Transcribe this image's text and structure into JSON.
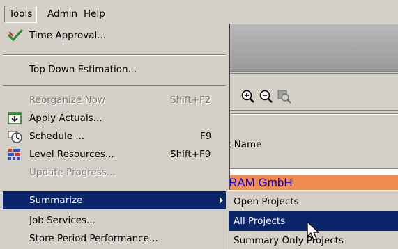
{
  "menubar": {
    "items": [
      {
        "label": "Tools"
      },
      {
        "label": "Admin"
      },
      {
        "label": "Help"
      }
    ]
  },
  "tools_menu": {
    "items": [
      {
        "label": "Time Approval...",
        "icon": "checkmark-icon"
      },
      {
        "label": "Top Down Estimation..."
      },
      {
        "label": "Reorganize Now",
        "shortcut": "Shift+F2",
        "disabled": true
      },
      {
        "label": "Apply Actuals...",
        "icon": "apply-actuals-icon"
      },
      {
        "label": "Schedule ...",
        "shortcut": "F9",
        "icon": "schedule-clock-icon"
      },
      {
        "label": "Level Resources...",
        "shortcut": "Shift+F9",
        "icon": "level-resources-icon"
      },
      {
        "label": "Update Progress...",
        "disabled": true
      },
      {
        "label": "Summarize",
        "has_submenu": true,
        "selected": true
      },
      {
        "label": "Job Services..."
      },
      {
        "label": "Store Period Performance..."
      }
    ]
  },
  "summarize_submenu": {
    "items": [
      {
        "label": "Open Projects"
      },
      {
        "label": "All Projects",
        "selected": true
      },
      {
        "label": "Summary Only Projects"
      }
    ]
  },
  "background_window": {
    "column_header": "t Name",
    "company_row_text": "RAM GmbH",
    "toolbar_icons": [
      "zoom-in-icon",
      "zoom-out-icon",
      "zoom-fit-icon"
    ]
  },
  "colors": {
    "menu_face": "#d4d0c8",
    "selection": "#0a246a",
    "company_row": "#f08c50",
    "company_text": "#0000ff"
  }
}
